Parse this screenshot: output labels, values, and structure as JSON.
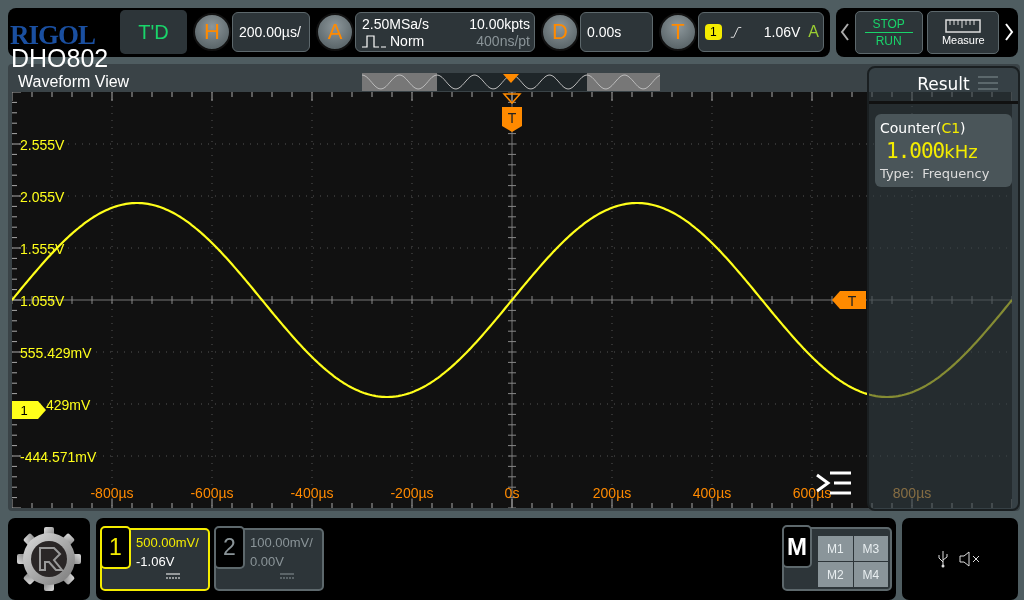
{
  "top_bar": {
    "brand": "RIGOL",
    "model": "DHO802",
    "mode": "T'D",
    "horizontal": {
      "letter": "H",
      "scale": "200.00µs/"
    },
    "acquire": {
      "letter": "A",
      "sample_rate": "2.50MSa/s",
      "mode": "Norm",
      "memory_depth": "10.00kpts",
      "resolution": "400ns/pt"
    },
    "delay": {
      "letter": "D",
      "value": "0.00s"
    },
    "trigger": {
      "letter": "T",
      "source": "1",
      "level": "1.06V",
      "sweep": "A"
    },
    "run_control": {
      "stop": "STOP",
      "run": "RUN"
    },
    "measure": {
      "label": "Measure"
    }
  },
  "waveform_view": {
    "title": "Waveform View",
    "y_labels": [
      "2.555V",
      "2.055V",
      "1.555V",
      "1.055V",
      "555.429mV",
      "429mV",
      "-444.571mV"
    ],
    "x_labels": [
      "-800µs",
      "-600µs",
      "-400µs",
      "-200µs",
      "0s",
      "200µs",
      "400µs",
      "600µs",
      "800µs"
    ],
    "trigger_marker": "T",
    "level_marker": "T",
    "channel_marker": "1"
  },
  "result": {
    "title": "Result",
    "counter": {
      "prefix": "Counter(",
      "source": "C1",
      "suffix": ")",
      "value": "1.000",
      "unit": "kHz",
      "type_label": "Type:",
      "type_value": "Frequency"
    }
  },
  "channels": [
    {
      "number": "1",
      "scale": "500.00mV/",
      "offset": "-1.06V",
      "selected": true
    },
    {
      "number": "2",
      "scale": "100.00mV/",
      "offset": "0.00V",
      "selected": false
    }
  ],
  "math": {
    "label": "M",
    "items": [
      "M1",
      "M3",
      "M2",
      "M4"
    ]
  }
}
